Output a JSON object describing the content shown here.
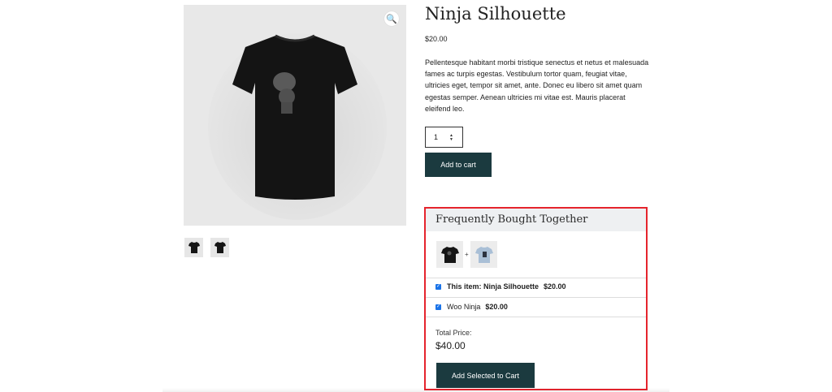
{
  "product": {
    "title": "Ninja Silhouette",
    "price": "$20.00",
    "description": "Pellentesque habitant morbi tristique senectus et netus et malesuada fames ac turpis egestas. Vestibulum tortor quam, feugiat vitae, ultricies eget, tempor sit amet, ante. Donec eu libero sit amet quam egestas semper. Aenean ultricies mi vitae est. Mauris placerat eleifend leo.",
    "quantity": "1",
    "add_to_cart_label": "Add to cart"
  },
  "gallery": {
    "zoom_icon": "magnifier-icon",
    "thumbnails": [
      "black-tshirt",
      "black-tshirt"
    ]
  },
  "bundle": {
    "title": "Frequently Bought Together",
    "plus": "+",
    "items": [
      {
        "label": "This item: Ninja Silhouette",
        "price": "$20.00",
        "checked": true
      },
      {
        "label": "Woo Ninja",
        "price": "$20.00",
        "checked": true
      }
    ],
    "total_label": "Total Price:",
    "total_value": "$40.00",
    "add_selected_label": "Add Selected to Cart"
  },
  "colors": {
    "button_bg": "#1b3a3f",
    "highlight_border": "#e5242d",
    "checkbox": "#1a73e8"
  }
}
